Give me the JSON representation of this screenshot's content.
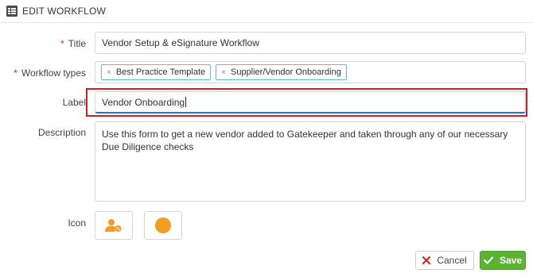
{
  "header": {
    "title": "EDIT WORKFLOW",
    "icon": "grid-icon"
  },
  "form": {
    "title": {
      "label": "Title",
      "required": "*",
      "value": "Vendor Setup & eSignature Workflow"
    },
    "workflow_types": {
      "label": "Workflow types",
      "required": "*",
      "tags": [
        {
          "label": "Best Practice Template",
          "remove": "×"
        },
        {
          "label": "Supplier/Vendor Onboarding",
          "remove": "×"
        }
      ]
    },
    "label_field": {
      "label": "Label",
      "value": "Vendor Onboarding"
    },
    "description": {
      "label": "Description",
      "value": "Use this form to get a new vendor added to Gatekeeper and taken through any of our necessary Due Diligence checks"
    },
    "icon": {
      "label": "Icon",
      "options": [
        "user-settings-icon",
        "circle-icon"
      ],
      "accent_color": "#f39c1f"
    }
  },
  "actions": {
    "cancel_label": "Cancel",
    "save_label": "Save",
    "save_color": "#5cb332",
    "cancel_icon_color": "#d9281c"
  },
  "highlight_color": "#d81e1e"
}
